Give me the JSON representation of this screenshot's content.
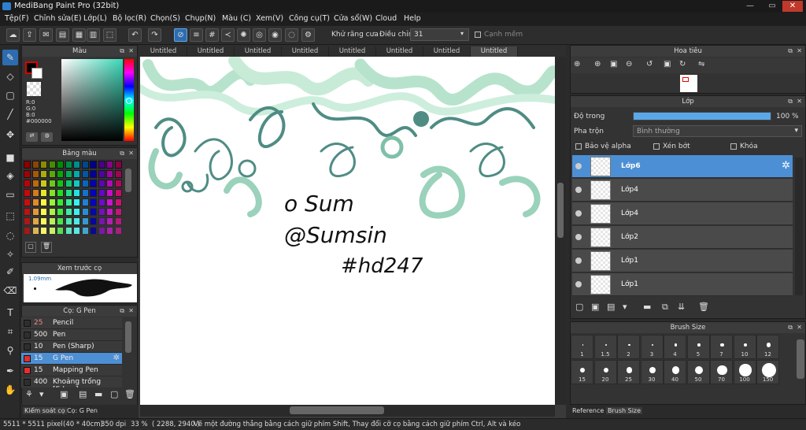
{
  "window": {
    "title": "MediBang Paint Pro (32bit)",
    "minimize": "—",
    "maximize": "▭",
    "close": "✕"
  },
  "menu": [
    "Tệp(F)",
    "Chỉnh sửa(E)",
    "Lớp(L)",
    "Bộ lọc(R)",
    "Chọn(S)",
    "Chụp(N)",
    "Màu (C)",
    "Xem(V)",
    "Công cụ(T)",
    "Cửa sổ(W)",
    "Cloud",
    "Help"
  ],
  "toolbar": {
    "antialias_label": "Khử răng cưa",
    "correction_label": "Điều chỉnh",
    "correction_value": "31",
    "sharp_label": "Cạnh mềm"
  },
  "tabs": [
    "Untitled",
    "Untitled",
    "Untitled",
    "Untitled",
    "Untitled",
    "Untitled",
    "Untitled",
    "Untitled"
  ],
  "color_panel": {
    "title": "Màu",
    "r": "R:0",
    "g": "G:0",
    "b": "B:0",
    "hex": "#000000"
  },
  "palette_panel": {
    "title": "Bảng màu"
  },
  "preview_panel": {
    "title": "Xem trước cọ",
    "size": "1.09mm"
  },
  "brush_panel": {
    "title": "Cọ: G Pen",
    "brushes": [
      {
        "size": "25",
        "name": "Pencil",
        "color": "#2e2e2e",
        "selected": false
      },
      {
        "size": "500",
        "name": "Pen",
        "color": "#2e2e2e",
        "selected": false
      },
      {
        "size": "10",
        "name": "Pen (Sharp)",
        "color": "#2e2e2e",
        "selected": false
      },
      {
        "size": "15",
        "name": "G Pen",
        "color": "#e03030",
        "selected": true
      },
      {
        "size": "15",
        "name": "Mapping Pen",
        "color": "#e03030",
        "selected": false
      },
      {
        "size": "400",
        "name": "Khoảng trống [Edge ]",
        "color": "#2e2e2e",
        "selected": false
      }
    ],
    "tabs": [
      "Kiểm soát cọ",
      "Cọ: G Pen"
    ]
  },
  "navigator": {
    "title": "Hoa tiêu"
  },
  "layer_panel": {
    "title": "Lớp",
    "opacity_label": "Độ trong",
    "opacity_value": "100 %",
    "opacity_fraction": 1.0,
    "blend_label": "Pha trộn",
    "blend_value": "Bình thường",
    "protect_alpha": "Bảo vệ alpha",
    "clipping": "Xén bớt",
    "lock": "Khóa",
    "layers": [
      {
        "name": "Lớp6",
        "selected": true
      },
      {
        "name": "Lớp4",
        "selected": false
      },
      {
        "name": "Lớp4",
        "selected": false
      },
      {
        "name": "Lớp2",
        "selected": false
      },
      {
        "name": "Lớp1",
        "selected": false
      },
      {
        "name": "Lớp1",
        "selected": false
      }
    ]
  },
  "brush_size_panel": {
    "title": "Brush Size",
    "sizes": [
      "1",
      "1.5",
      "2",
      "3",
      "4",
      "5",
      "7",
      "10",
      "12",
      "15",
      "20",
      "25",
      "30",
      "40",
      "50",
      "70",
      "100",
      "150"
    ],
    "tabs": [
      "Reference",
      "Brush Size"
    ]
  },
  "canvas": {
    "handwriting": [
      "o Sum",
      "@Sumsin",
      "#hd247"
    ]
  },
  "status": {
    "dimensions": "5511 * 5511 pixel",
    "physical": "(40 * 40cm)",
    "dpi": "350 dpi",
    "zoom": "33 %",
    "coords": "( 2288, 2940 )",
    "hint": "Vẽ một đường thẳng bằng cách giữ phím Shift, Thay đổi cỡ cọ bằng cách giữ phím Ctrl, Alt và kéo"
  }
}
